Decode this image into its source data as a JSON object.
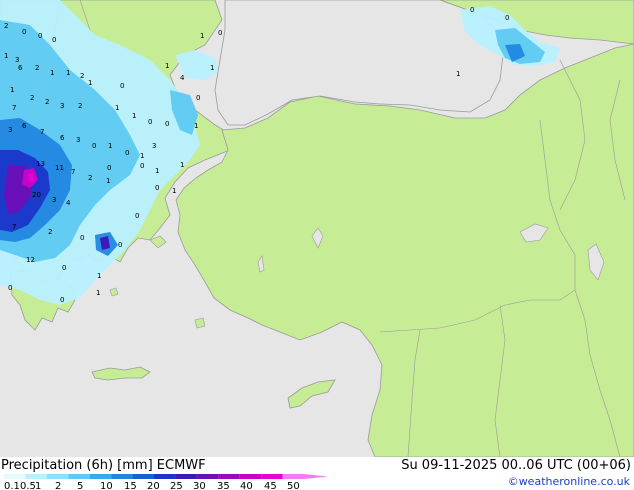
{
  "footer": {
    "title": "Precipitation (6h) [mm] ECMWF",
    "valid": "Su 09-11-2025 00..06 UTC (00+06)",
    "credit": "©weatheronline.co.uk"
  },
  "legend": {
    "labels": [
      "0.1",
      "0.5",
      "1",
      "2",
      "5",
      "10",
      "15",
      "20",
      "25",
      "30",
      "35",
      "40",
      "45",
      "50"
    ],
    "colors": [
      "#e6fbff",
      "#b8f0ff",
      "#8ee0fa",
      "#5ec9f2",
      "#35aaea",
      "#2286e0",
      "#1a5fd6",
      "#1a35c8",
      "#3a1ab8",
      "#6a10b8",
      "#9a08c0",
      "#c604c8",
      "#e800d8",
      "#f07ef0"
    ]
  },
  "colors": {
    "sea": "#e6e6e6",
    "land": "#c6ec96",
    "coast": "#9a9a9a"
  },
  "precip_values": [
    {
      "t": "2"
    },
    {
      "t": "0"
    },
    {
      "t": "0"
    },
    {
      "t": "0"
    },
    {
      "t": "1"
    },
    {
      "t": "3"
    },
    {
      "t": "6"
    },
    {
      "t": "2"
    },
    {
      "t": "1"
    },
    {
      "t": "2"
    },
    {
      "t": "1"
    },
    {
      "t": "7"
    },
    {
      "t": "1"
    },
    {
      "t": "2"
    },
    {
      "t": "2"
    },
    {
      "t": "3"
    },
    {
      "t": "2"
    },
    {
      "t": "6"
    },
    {
      "t": "3"
    },
    {
      "t": "7"
    },
    {
      "t": "6"
    },
    {
      "t": "3"
    },
    {
      "t": "0"
    },
    {
      "t": "13"
    },
    {
      "t": "11"
    },
    {
      "t": "7"
    },
    {
      "t": "2"
    },
    {
      "t": "1"
    },
    {
      "t": "20"
    },
    {
      "t": "3"
    },
    {
      "t": "4"
    },
    {
      "t": "7"
    },
    {
      "t": "2"
    },
    {
      "t": "0"
    },
    {
      "t": "12"
    },
    {
      "t": "0"
    },
    {
      "t": "1"
    },
    {
      "t": "0"
    },
    {
      "t": "0"
    },
    {
      "t": "1"
    },
    {
      "t": "1"
    },
    {
      "t": "0"
    },
    {
      "t": "0"
    },
    {
      "t": "3"
    },
    {
      "t": "1"
    },
    {
      "t": "0"
    },
    {
      "t": "1"
    },
    {
      "t": "0"
    },
    {
      "t": "0"
    },
    {
      "t": "1"
    },
    {
      "t": "1"
    },
    {
      "t": "0"
    },
    {
      "t": "0"
    },
    {
      "t": "1"
    },
    {
      "t": "1"
    },
    {
      "t": "0"
    },
    {
      "t": "1"
    },
    {
      "t": "1"
    },
    {
      "t": "0"
    },
    {
      "t": "4"
    },
    {
      "t": "1"
    },
    {
      "t": "0"
    },
    {
      "t": "1"
    },
    {
      "t": "0"
    },
    {
      "t": "1"
    },
    {
      "t": "0"
    },
    {
      "t": "0"
    },
    {
      "t": "1"
    }
  ]
}
